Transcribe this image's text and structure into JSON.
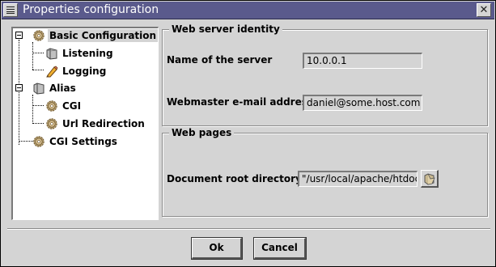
{
  "window": {
    "title": "Properties configuration",
    "close_glyph": "✕",
    "colors": {
      "titlebar": "#5a5a8c",
      "background": "#d4d4d4"
    }
  },
  "tree": {
    "items": [
      {
        "label": "Basic Configuration",
        "icon": "gear-icon",
        "selected": true
      },
      {
        "label": "Listening",
        "icon": "folder-icon"
      },
      {
        "label": "Logging",
        "icon": "pencil-icon"
      },
      {
        "label": "Alias",
        "icon": "folder-icon"
      },
      {
        "label": "CGI",
        "icon": "gear-icon"
      },
      {
        "label": "Url Redirection",
        "icon": "gear-icon"
      },
      {
        "label": "CGI Settings",
        "icon": "gear-icon"
      }
    ]
  },
  "identity_group": {
    "title": "Web server identity",
    "server_name_label": "Name of the server",
    "server_name_value": "10.0.0.1",
    "webmaster_label": "Webmaster e-mail address",
    "webmaster_value": "daniel@some.host.com"
  },
  "pages_group": {
    "title": "Web pages",
    "docroot_label": "Document root directory",
    "docroot_value": "\"/usr/local/apache/htdocs\"",
    "browse_icon": "folder-open-icon"
  },
  "buttons": {
    "ok_label": "Ok",
    "cancel_label": "Cancel"
  }
}
